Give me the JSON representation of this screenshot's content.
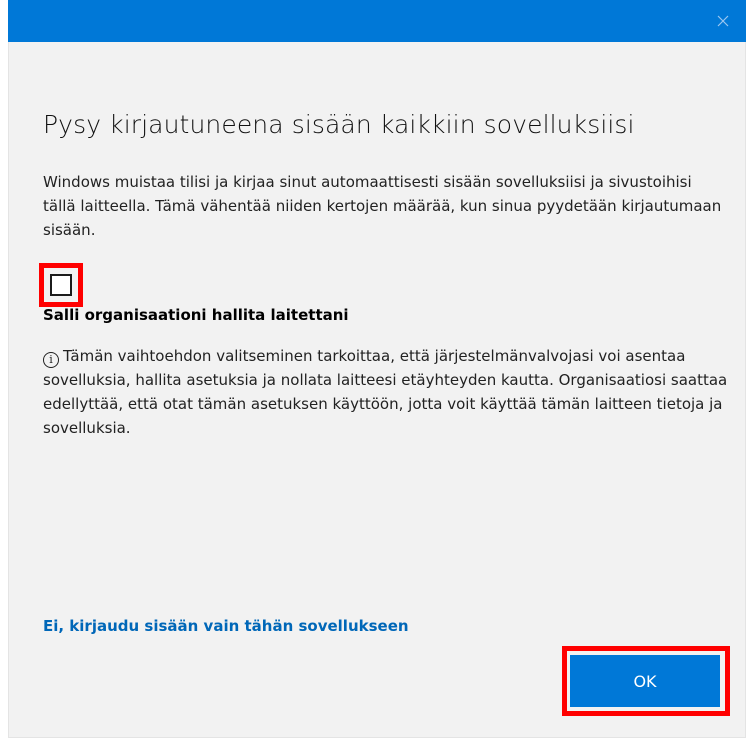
{
  "titlebar": {
    "close_icon": "close-icon"
  },
  "dialog": {
    "heading": "Pysy kirjautuneena sisään kaikkiin sovelluksiisi",
    "description": "Windows muistaa tilisi ja kirjaa sinut automaattisesti sisään sovelluksiisi ja sivustoihisi tällä laitteella. Tämä vähentää niiden kertojen määrää, kun sinua pyydetään kirjautumaan sisään.",
    "checkbox": {
      "checked": false,
      "label": "Salli organisaationi hallita laitettani"
    },
    "info": {
      "icon": "info-icon",
      "text": "Tämän vaihtoehdon valitseminen tarkoittaa, että järjestelmänvalvojasi voi asentaa sovelluksia, hallita asetuksia ja nollata laitteesi etäyhteyden kautta. Organisaatiosi saattaa edellyttää, että otat tämän asetuksen käyttöön, jotta voit käyttää tämän laitteen tietoja ja sovelluksia."
    },
    "alt_link": "Ei, kirjaudu sisään vain tähän sovellukseen",
    "ok_label": "OK"
  },
  "colors": {
    "accent": "#0078d7",
    "link": "#0067b8",
    "highlight": "#ff0000",
    "background": "#f2f2f2"
  }
}
